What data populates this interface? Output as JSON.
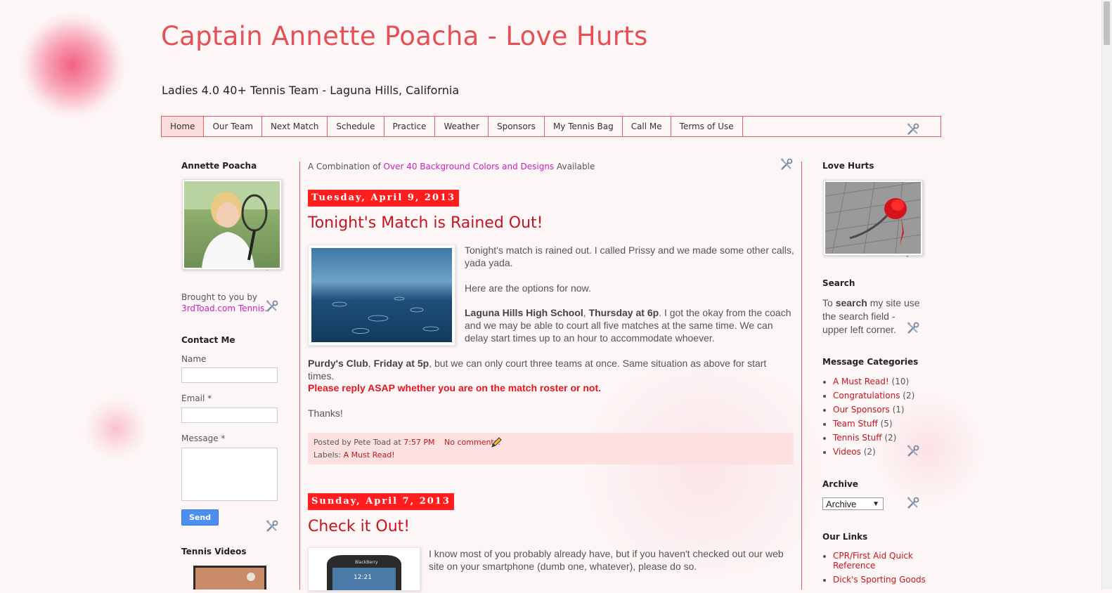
{
  "header": {
    "title": "Captain Annette Poacha - Love Hurts",
    "description": "Ladies 4.0 40+ Tennis Team - Laguna Hills, California"
  },
  "nav": {
    "tabs": [
      "Home",
      "Our Team",
      "Next Match",
      "Schedule",
      "Practice",
      "Weather",
      "Sponsors",
      "My Tennis Bag",
      "Call Me",
      "Terms of Use"
    ],
    "active": "Home"
  },
  "left_sidebar": {
    "profile_title": "Annette Poacha",
    "brought_by": "Brought to you by",
    "brought_link": "3rdToad.com Tennis",
    "brought_period": ".",
    "contact_title": "Contact Me",
    "name_label": "Name",
    "email_label": "Email *",
    "message_label": "Message *",
    "send_label": "Send",
    "videos_title": "Tennis Videos"
  },
  "main": {
    "top_prefix": "A Combination of",
    "top_link": "Over 40 Background Colors and Designs",
    "top_suffix": "Available",
    "posts": [
      {
        "date": "Tuesday, April 9, 2013",
        "title": "Tonight's Match is Rained Out!",
        "p1": "Tonight's match is rained out. I called Prissy and we made some other calls, yada yada.",
        "p2": "Here are the options for now.",
        "p3_b1": "Laguna Hills High School",
        "p3_sep": ", ",
        "p3_b2": "Thursday at 6p",
        "p3_rest": ". I got the okay from the coach and we may be able to court all five matches at the same time. We can delay start times up to an hour to accommodate whoever.",
        "p4_b1": "Purdy's Club",
        "p4_sep": ", ",
        "p4_b2": "Friday at 5p",
        "p4_rest": ", but we can only court three teams at once. Same situation as above for start times.",
        "p5": "Please reply ASAP whether you are on the match roster or not.",
        "p6": "Thanks!",
        "posted_by": "Posted by Pete Toad at",
        "time": "7:57 PM",
        "comments": "No comments:",
        "labels_prefix": "Labels:",
        "label": "A Must Read!"
      },
      {
        "date": "Sunday, April 7, 2013",
        "title": "Check it Out!",
        "p1": "I know most of you probably already have, but if you haven't checked out our web site on your smartphone (dumb one, whatever), please do so.",
        "phone_brand": "BlackBerry",
        "phone_time": "12:21"
      }
    ]
  },
  "right_sidebar": {
    "love_title": "Love Hurts",
    "search_title": "Search",
    "search_pre": "To",
    "search_bold": "search",
    "search_post": "my site use the search field - upper left corner.",
    "categories_title": "Message Categories",
    "categories": [
      {
        "name": "A Must Read!",
        "count": "(10)"
      },
      {
        "name": "Congratulations",
        "count": "(2)"
      },
      {
        "name": "Our Sponsors",
        "count": "(1)"
      },
      {
        "name": "Team Stuff",
        "count": "(5)"
      },
      {
        "name": "Tennis Stuff",
        "count": "(2)"
      },
      {
        "name": "Videos",
        "count": "(2)"
      }
    ],
    "archive_title": "Archive",
    "archive_value": "Archive",
    "links_title": "Our Links",
    "links": [
      "CPR/First Aid Quick Reference",
      "Dick's Sporting Goods"
    ]
  },
  "colors": {
    "accent": "#e84e55",
    "date_bg": "#ff1d1d",
    "link_purple": "#cc1fc2",
    "link_red": "#c8141e",
    "footer_bg": "#fde1e1"
  },
  "icons": [
    "wrench-screwdriver-icon",
    "pencil-icon",
    "dropdown-arrow-icon"
  ]
}
